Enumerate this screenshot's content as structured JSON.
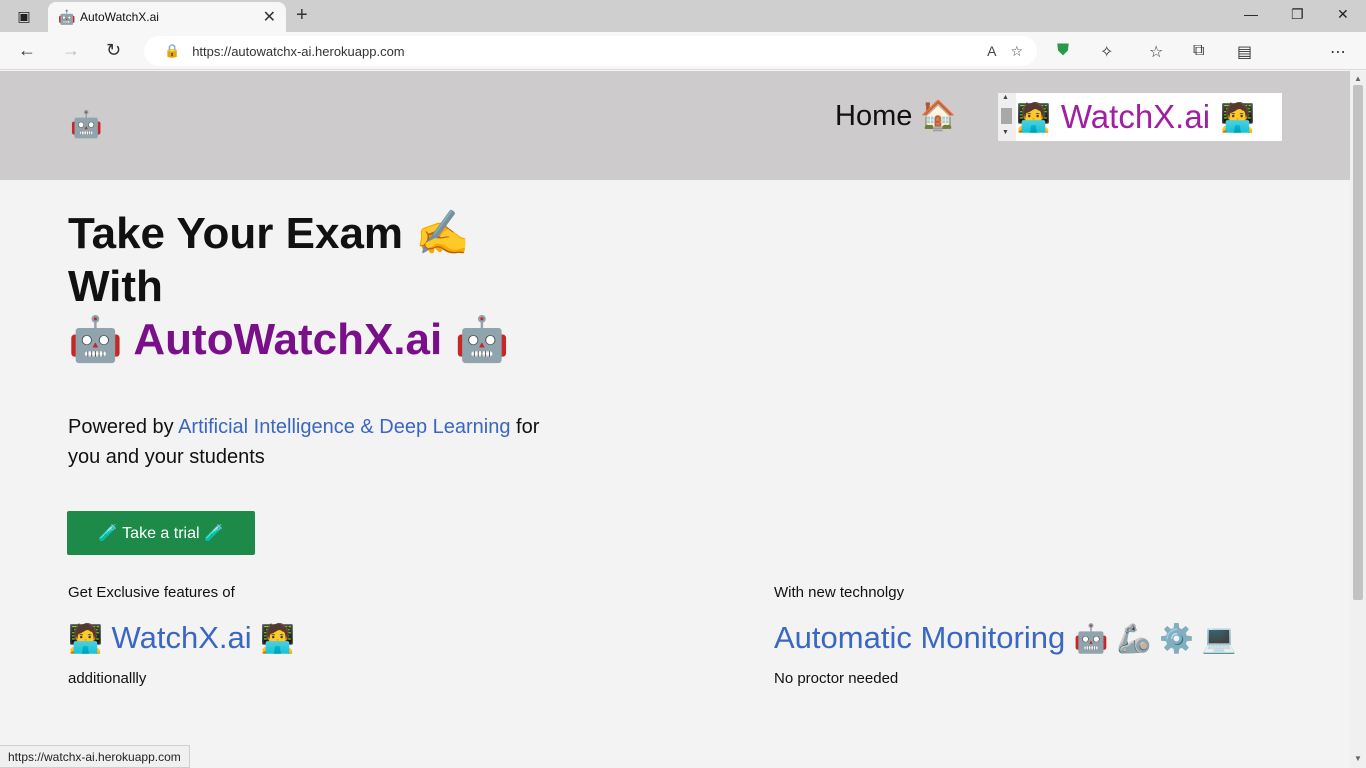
{
  "browser": {
    "tab_title": "AutoWatchX.ai",
    "tab_favicon": "🤖",
    "url": "https://autowatchx-ai.herokuapp.com",
    "status_url": "https://watchx-ai.herokuapp.com"
  },
  "header": {
    "logo": "🤖",
    "home_label": "Home 🏠",
    "brand_label": "WatchX.ai",
    "brand_emoji": "🧑‍💻"
  },
  "hero": {
    "line1": "Take Your Exam ✍️",
    "line2": "With",
    "brand_emoji": "🤖",
    "brand": "AutoWatchX.ai"
  },
  "powered": {
    "prefix": "Powered by ",
    "link": "Artificial Intelligence & Deep Learning",
    "suffix": " for you and your students"
  },
  "trial_button": "🧪 Take a trial 🧪",
  "features": {
    "left": {
      "caption": "Get Exclusive features of",
      "title": "WatchX.ai",
      "emoji": "🧑‍💻",
      "sub": "additionallly"
    },
    "right": {
      "caption": "With new technolgy",
      "title": "Automatic Monitoring",
      "emojis": "🤖 🦾 ⚙️ 💻",
      "sub": "No proctor needed"
    }
  },
  "colors": {
    "header_bg": "#cdcbcb",
    "brand_purple": "#7a0f8a",
    "link_blue": "#3a67c2",
    "button_green": "#1e8a4a"
  }
}
